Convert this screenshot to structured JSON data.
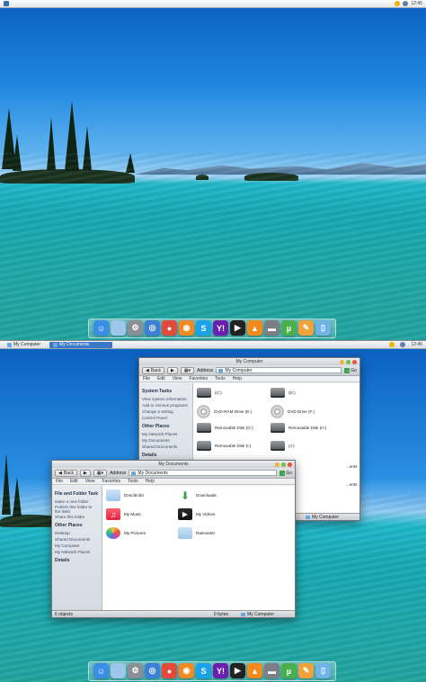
{
  "top_menubar": {
    "clock": "12:45"
  },
  "taskbar": {
    "button_my_computer": "My Computer",
    "button_my_documents": "My Documents",
    "clock": "12:45"
  },
  "dock_icons": [
    "finder-icon",
    "launchpad-icon",
    "settings-icon",
    "safari-icon",
    "chrome-icon",
    "firefox-icon",
    "skype-icon",
    "yahoo-icon",
    "media-icon",
    "vlc-icon",
    "hdd-icon",
    "utorrent-icon",
    "app-icon",
    "trash-icon"
  ],
  "window_my_computer": {
    "title": "My Computer",
    "back": "Back",
    "address_label": "Address",
    "address_value": "My Computer",
    "go": "Go",
    "menu": [
      "File",
      "Edit",
      "View",
      "Favorites",
      "Tools",
      "Help"
    ],
    "sidepane": {
      "system_tasks_head": "System Tasks",
      "system_tasks": [
        "View system information",
        "Add or remove programs",
        "Change a setting"
      ],
      "control_panel": "Control Panel",
      "other_places_head": "Other Places",
      "other_places": [
        "My Network Places",
        "My Documents",
        "Shared Documents"
      ],
      "details_head": "Details"
    },
    "items": [
      {
        "label": "(C:)",
        "icon": "hard-drive"
      },
      {
        "label": "(D:)",
        "icon": "hard-drive"
      },
      {
        "label": "DVD-RAM Drive (E:)",
        "icon": "disc"
      },
      {
        "label": "DVD Drive (F:)",
        "icon": "disc"
      },
      {
        "label": "Removable Disk (G:)",
        "icon": "hard-drive"
      },
      {
        "label": "Removable Disk (H:)",
        "icon": "hard-drive"
      },
      {
        "label": "Removable Disk (I:)",
        "icon": "hard-drive"
      },
      {
        "label": "(J:)",
        "icon": "hard-drive"
      },
      {
        "label": "...ents",
        "icon": "folder"
      },
      {
        "label": "...ents",
        "icon": "folder"
      }
    ],
    "status_right": "My Computer"
  },
  "window_my_documents": {
    "title": "My Documents",
    "back": "Back",
    "address_label": "Address",
    "address_value": "My Documents",
    "go": "Go",
    "menu": [
      "File",
      "Edit",
      "View",
      "Favorites",
      "Tools",
      "Help"
    ],
    "sidepane": {
      "file_folder_head": "File and Folder Task",
      "file_folder_tasks": [
        "Make a new folder",
        "Publish this folder to the Web",
        "Share this folder"
      ],
      "other_places_head": "Other Places",
      "other_places": [
        "Desktop",
        "Shared Documents",
        "My Computer",
        "My Network Places"
      ],
      "details_head": "Details"
    },
    "items": [
      {
        "label": "Descărcări",
        "icon": "folder"
      },
      {
        "label": "Downloads",
        "icon": "download-folder"
      },
      {
        "label": "My Music",
        "icon": "music-folder"
      },
      {
        "label": "My Videos",
        "icon": "video-folder"
      },
      {
        "label": "My Pictures",
        "icon": "photos-folder"
      },
      {
        "label": "Rainmeter",
        "icon": "folder"
      }
    ],
    "status_left": "6 objects",
    "status_mid": "0 bytes",
    "status_right": "My Computer"
  }
}
